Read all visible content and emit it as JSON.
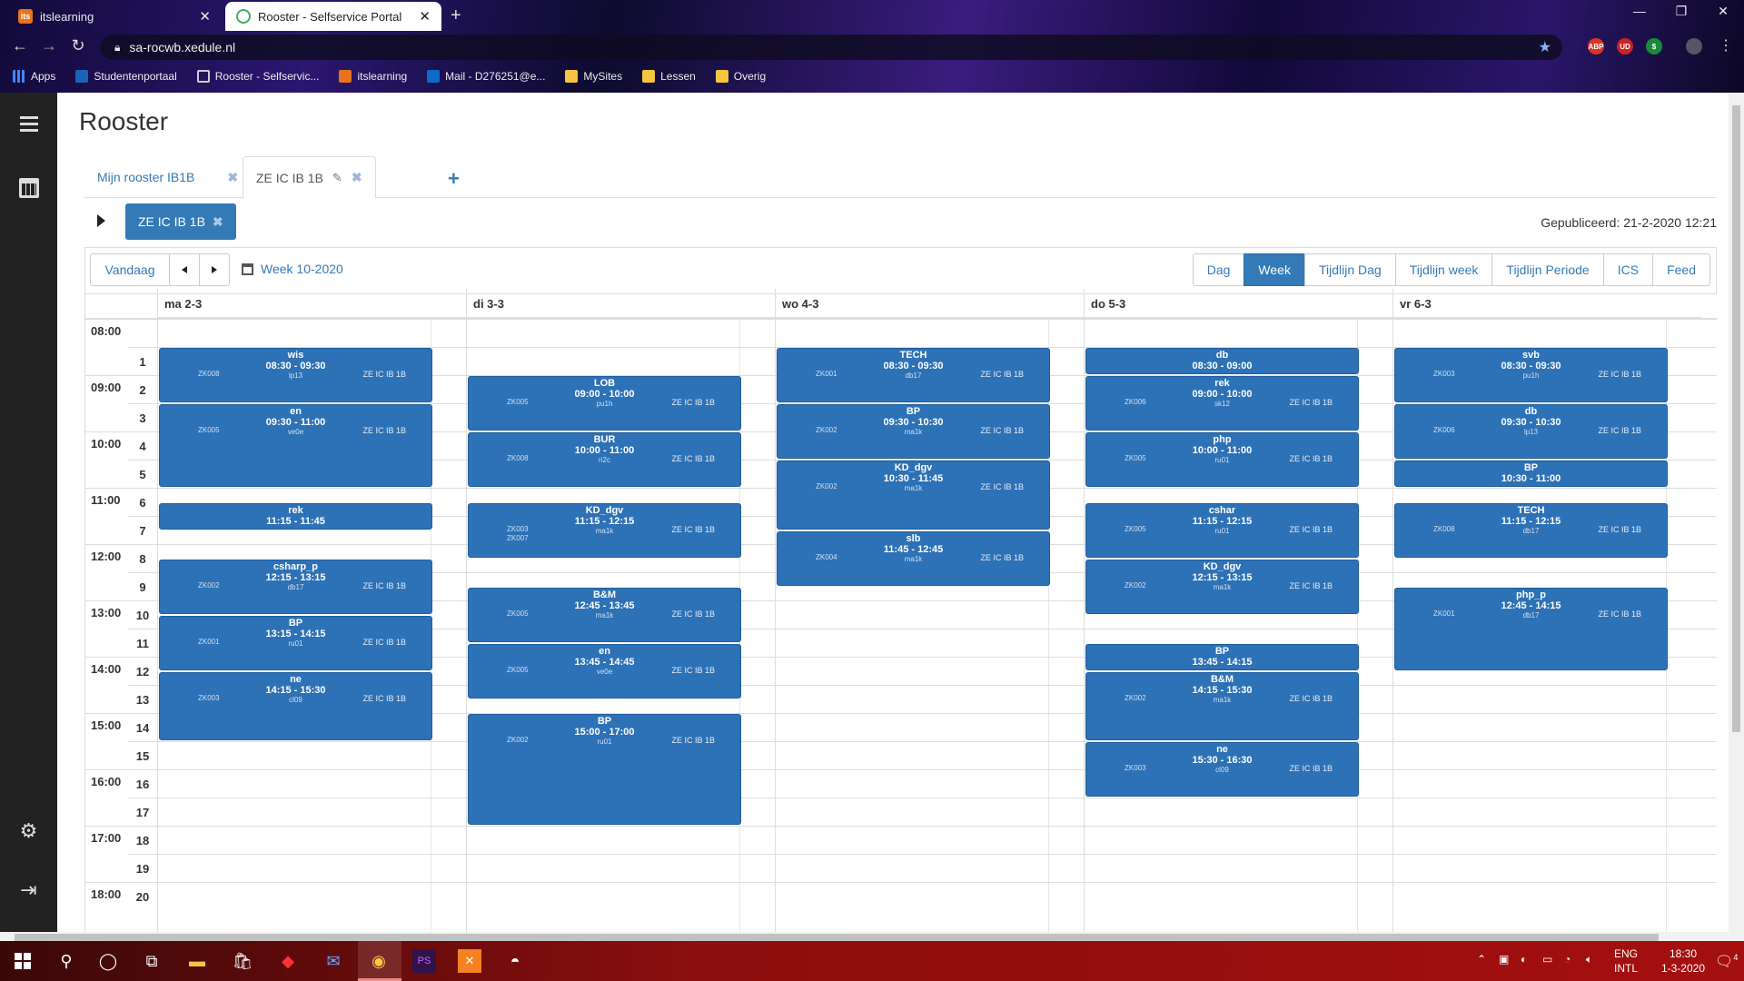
{
  "browser": {
    "tabs": [
      {
        "title": "itslearning",
        "active": false
      },
      {
        "title": "Rooster - Selfservice Portal",
        "active": true
      }
    ],
    "url": "sa-rocwb.xedule.nl",
    "bookmarks": [
      "Apps",
      "Studentenportaal",
      "Rooster - Selfservic...",
      "itslearning",
      "Mail - D276251@e...",
      "MySites",
      "Lessen",
      "Overig"
    ],
    "extensions": [
      "ABP",
      "UD",
      "$"
    ]
  },
  "page": {
    "title": "Rooster",
    "tabs": [
      {
        "label": "Mijn rooster IB1B"
      },
      {
        "label": "ZE IC IB 1B"
      }
    ],
    "filter_chip": "ZE IC IB 1B",
    "published": "Gepubliceerd: 21-2-2020 12:21"
  },
  "toolbar": {
    "today": "Vandaag",
    "week_label": "Week 10-2020",
    "views": [
      "Dag",
      "Week",
      "Tijdlijn Dag",
      "Tijdlijn week",
      "Tijdlijn Periode",
      "ICS",
      "Feed"
    ],
    "active_view": "Week"
  },
  "days": [
    "ma 2-3",
    "di 3-3",
    "wo 4-3",
    "do 5-3",
    "vr 6-3"
  ],
  "hours": [
    "08:00",
    "09:00",
    "10:00",
    "11:00",
    "12:00",
    "13:00",
    "14:00",
    "15:00",
    "16:00",
    "17:00",
    "18:00"
  ],
  "periods": [
    "1",
    "2",
    "3",
    "4",
    "5",
    "6",
    "7",
    "8",
    "9",
    "10",
    "11",
    "12",
    "13",
    "14",
    "15",
    "16",
    "17",
    "18",
    "19",
    "20"
  ],
  "events": [
    {
      "day": 0,
      "start": "08:30",
      "end": "09:30",
      "title": "wis",
      "time": "08:30 - 09:30",
      "room": "lp13",
      "staff": "ZK008",
      "group": "ZE IC IB 1B"
    },
    {
      "day": 0,
      "start": "09:30",
      "end": "11:00",
      "title": "en",
      "time": "09:30 - 11:00",
      "room": "ve0e",
      "staff": "ZK005",
      "group": "ZE IC IB 1B"
    },
    {
      "day": 0,
      "start": "11:15",
      "end": "11:45",
      "title": "rek",
      "time": "11:15 - 11:45",
      "room": "",
      "staff": "",
      "group": ""
    },
    {
      "day": 0,
      "start": "12:15",
      "end": "13:15",
      "title": "csharp_p",
      "time": "12:15 - 13:15",
      "room": "db17",
      "staff": "ZK002",
      "group": "ZE IC IB 1B"
    },
    {
      "day": 0,
      "start": "13:15",
      "end": "14:15",
      "title": "BP",
      "time": "13:15 - 14:15",
      "room": "ru01",
      "staff": "ZK001",
      "group": "ZE IC IB 1B"
    },
    {
      "day": 0,
      "start": "14:15",
      "end": "15:30",
      "title": "ne",
      "time": "14:15 - 15:30",
      "room": "cl09",
      "staff": "ZK003",
      "group": "ZE IC IB 1B"
    },
    {
      "day": 1,
      "start": "09:00",
      "end": "10:00",
      "title": "LOB",
      "time": "09:00 - 10:00",
      "room": "pu1h",
      "staff": "ZK005",
      "group": "ZE IC IB 1B"
    },
    {
      "day": 1,
      "start": "10:00",
      "end": "11:00",
      "title": "BUR",
      "time": "10:00 - 11:00",
      "room": "ri2c",
      "staff": "ZK008",
      "group": "ZE IC IB 1B"
    },
    {
      "day": 1,
      "start": "11:15",
      "end": "12:15",
      "title": "KD_dgv",
      "time": "11:15 - 12:15",
      "room": "ma1k",
      "staff": "ZK003",
      "staff2": "ZK007",
      "group": "ZE IC IB 1B"
    },
    {
      "day": 1,
      "start": "12:45",
      "end": "13:45",
      "title": "B&M",
      "time": "12:45 - 13:45",
      "room": "ma1k",
      "staff": "ZK005",
      "group": "ZE IC IB 1B"
    },
    {
      "day": 1,
      "start": "13:45",
      "end": "14:45",
      "title": "en",
      "time": "13:45 - 14:45",
      "room": "ve0e",
      "staff": "ZK005",
      "group": "ZE IC IB 1B"
    },
    {
      "day": 1,
      "start": "15:00",
      "end": "17:00",
      "title": "BP",
      "time": "15:00 - 17:00",
      "room": "ru01",
      "staff": "ZK002",
      "group": "ZE IC IB 1B"
    },
    {
      "day": 2,
      "start": "08:30",
      "end": "09:30",
      "title": "TECH",
      "time": "08:30 - 09:30",
      "room": "db17",
      "staff": "ZK001",
      "group": "ZE IC IB 1B"
    },
    {
      "day": 2,
      "start": "09:30",
      "end": "10:30",
      "title": "BP",
      "time": "09:30 - 10:30",
      "room": "ma1k",
      "staff": "ZK002",
      "group": "ZE IC IB 1B"
    },
    {
      "day": 2,
      "start": "10:30",
      "end": "11:45",
      "title": "KD_dgv",
      "time": "10:30 - 11:45",
      "room": "ma1k",
      "staff": "ZK002",
      "group": "ZE IC IB 1B"
    },
    {
      "day": 2,
      "start": "11:45",
      "end": "12:45",
      "title": "slb",
      "time": "11:45 - 12:45",
      "room": "ma1k",
      "staff": "ZK004",
      "group": "ZE IC IB 1B"
    },
    {
      "day": 3,
      "start": "08:30",
      "end": "09:00",
      "title": "db",
      "time": "08:30 - 09:00",
      "room": "",
      "staff": "",
      "group": ""
    },
    {
      "day": 3,
      "start": "09:00",
      "end": "10:00",
      "title": "rek",
      "time": "09:00 - 10:00",
      "room": "sk12",
      "staff": "ZK006",
      "group": "ZE IC IB 1B"
    },
    {
      "day": 3,
      "start": "10:00",
      "end": "11:00",
      "title": "php",
      "time": "10:00 - 11:00",
      "room": "ru01",
      "staff": "ZK005",
      "group": "ZE IC IB 1B"
    },
    {
      "day": 3,
      "start": "11:15",
      "end": "12:15",
      "title": "cshar",
      "time": "11:15 - 12:15",
      "room": "ru01",
      "staff": "ZK005",
      "group": "ZE IC IB 1B"
    },
    {
      "day": 3,
      "start": "12:15",
      "end": "13:15",
      "title": "KD_dgv",
      "time": "12:15 - 13:15",
      "room": "ma1k",
      "staff": "ZK002",
      "group": "ZE IC IB 1B"
    },
    {
      "day": 3,
      "start": "13:45",
      "end": "14:15",
      "title": "BP",
      "time": "13:45 - 14:15",
      "room": "",
      "staff": "",
      "group": ""
    },
    {
      "day": 3,
      "start": "14:15",
      "end": "15:30",
      "title": "B&M",
      "time": "14:15 - 15:30",
      "room": "ma1k",
      "staff": "ZK002",
      "group": "ZE IC IB 1B"
    },
    {
      "day": 3,
      "start": "15:30",
      "end": "16:30",
      "title": "ne",
      "time": "15:30 - 16:30",
      "room": "cl09",
      "staff": "ZK003",
      "group": "ZE IC IB 1B"
    },
    {
      "day": 4,
      "start": "08:30",
      "end": "09:30",
      "title": "svb",
      "time": "08:30 - 09:30",
      "room": "pu1h",
      "staff": "ZK003",
      "group": "ZE IC IB 1B"
    },
    {
      "day": 4,
      "start": "09:30",
      "end": "10:30",
      "title": "db",
      "time": "09:30 - 10:30",
      "room": "lp13",
      "staff": "ZK006",
      "group": "ZE IC IB 1B"
    },
    {
      "day": 4,
      "start": "10:30",
      "end": "11:00",
      "title": "BP",
      "time": "10:30 - 11:00",
      "room": "",
      "staff": "",
      "group": ""
    },
    {
      "day": 4,
      "start": "11:15",
      "end": "12:15",
      "title": "TECH",
      "time": "11:15 - 12:15",
      "room": "db17",
      "staff": "ZK008",
      "group": "ZE IC IB 1B"
    },
    {
      "day": 4,
      "start": "12:45",
      "end": "14:15",
      "title": "php_p",
      "time": "12:45 - 14:15",
      "room": "db17",
      "staff": "ZK001",
      "group": "ZE IC IB 1B"
    }
  ],
  "taskbar": {
    "lang": "ENG",
    "layout": "INTL",
    "time": "18:30",
    "date": "1-3-2020",
    "notifications": "4"
  },
  "colors": {
    "primary": "#337ab7",
    "event": "#2d71b6",
    "sidebar": "#222222"
  }
}
